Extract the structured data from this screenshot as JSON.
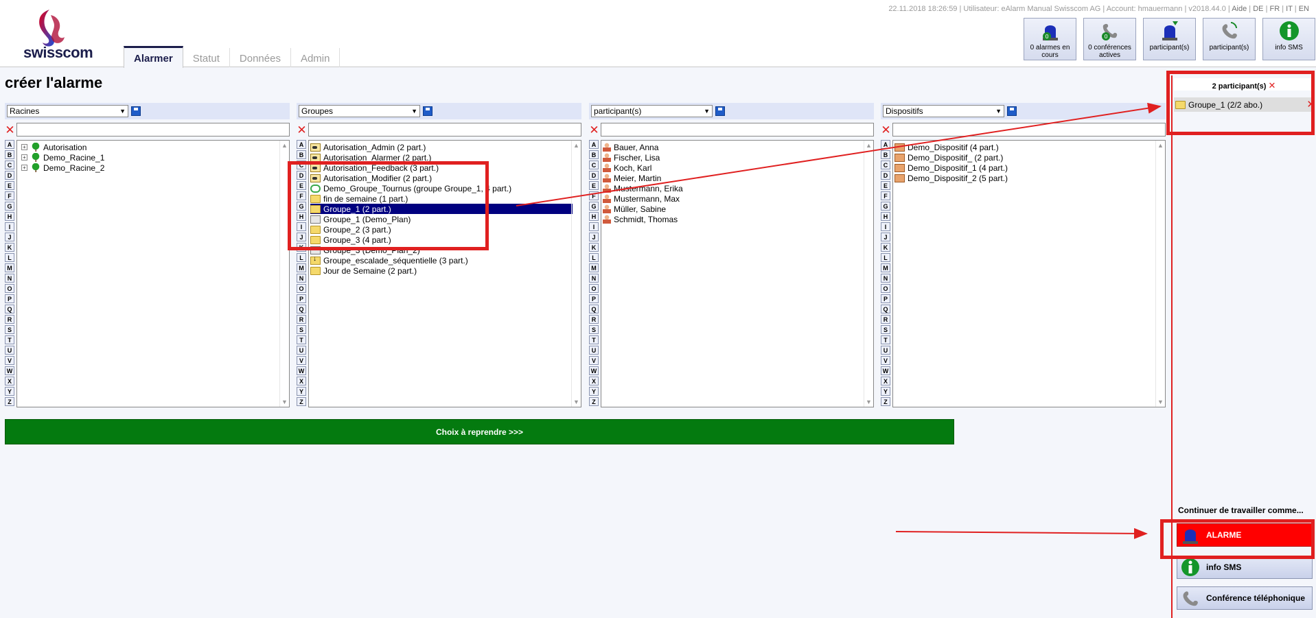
{
  "header": {
    "logo_text": "swisscom",
    "meta": {
      "datetime": "22.11.2018 18:26:59",
      "user_label": "Utilisateur:",
      "user": "eAlarm Manual Swisscom AG",
      "account_label": "Account:",
      "account": "hmauermann",
      "version": "v2018.44.0",
      "help": "Aide",
      "langs": [
        "DE",
        "FR",
        "IT",
        "EN"
      ]
    },
    "tabs": [
      {
        "label": "Alarmer",
        "active": true
      },
      {
        "label": "Statut",
        "active": false
      },
      {
        "label": "Données",
        "active": false
      },
      {
        "label": "Admin",
        "active": false
      }
    ],
    "buttons": [
      {
        "label": "0 alarmes en cours",
        "icon": "alarm-light-icon"
      },
      {
        "label": "0 conférences actives",
        "icon": "conference-icon"
      },
      {
        "label": "participant(s)",
        "icon": "alarm-light-icon"
      },
      {
        "label": "participant(s)",
        "icon": "phone-icon"
      },
      {
        "label": "info SMS",
        "icon": "info-icon"
      }
    ]
  },
  "page_title": "créer l'alarme",
  "letters": [
    "A",
    "B",
    "C",
    "D",
    "E",
    "F",
    "G",
    "H",
    "I",
    "J",
    "K",
    "L",
    "M",
    "N",
    "O",
    "P",
    "Q",
    "R",
    "S",
    "T",
    "U",
    "V",
    "W",
    "X",
    "Y",
    "Z"
  ],
  "columns": [
    {
      "select": "Racines",
      "items": [
        {
          "label": "Autorisation",
          "icon": "tree"
        },
        {
          "label": "Demo_Racine_1",
          "icon": "tree"
        },
        {
          "label": "Demo_Racine_2",
          "icon": "tree"
        }
      ]
    },
    {
      "select": "Groupes",
      "items": [
        {
          "label": "Autorisation_Admin (2 part.)",
          "icon": "key"
        },
        {
          "label": "Autorisation_Alarmer (2 part.)",
          "icon": "key"
        },
        {
          "label": "Autorisation_Feedback (3 part.)",
          "icon": "key"
        },
        {
          "label": "Autorisation_Modifier (2 part.)",
          "icon": "key"
        },
        {
          "label": "Demo_Groupe_Tournus (groupe Groupe_1, 4 part.)",
          "icon": "cycle"
        },
        {
          "label": "fin de semaine (1 part.)",
          "icon": "folder"
        },
        {
          "label": "Groupe_1 (2 part.)",
          "icon": "folder",
          "selected": true
        },
        {
          "label": "Groupe_1 (Demo_Plan)",
          "icon": "plan"
        },
        {
          "label": "Groupe_2 (3 part.)",
          "icon": "folder"
        },
        {
          "label": "Groupe_3 (4 part.)",
          "icon": "folder"
        },
        {
          "label": "Groupe_3 (Demo_Plan_2)",
          "icon": "plan"
        },
        {
          "label": "Groupe_escalade_séquentielle (3 part.)",
          "icon": "escalation"
        },
        {
          "label": "Jour de Semaine (2 part.)",
          "icon": "folder"
        }
      ]
    },
    {
      "select": "participant(s)",
      "items": [
        {
          "label": "Bauer, Anna",
          "icon": "person"
        },
        {
          "label": "Fischer, Lisa",
          "icon": "person"
        },
        {
          "label": "Koch, Karl",
          "icon": "person"
        },
        {
          "label": "Meier, Martin",
          "icon": "person"
        },
        {
          "label": "Mustermann, Erika",
          "icon": "person"
        },
        {
          "label": "Mustermann, Max",
          "icon": "person"
        },
        {
          "label": "Müller, Sabine",
          "icon": "person"
        },
        {
          "label": "Schmidt, Thomas",
          "icon": "person"
        }
      ]
    },
    {
      "select": "Dispositifs",
      "items": [
        {
          "label": "Demo_Dispositif (4 part.)",
          "icon": "device"
        },
        {
          "label": "Demo_Dispositif_ (2 part.)",
          "icon": "device"
        },
        {
          "label": "Demo_Dispositif_1 (4 part.)",
          "icon": "device"
        },
        {
          "label": "Demo_Dispositif_2 (5 part.)",
          "icon": "device"
        }
      ]
    }
  ],
  "choose_button": "Choix à reprendre >>>",
  "selection": {
    "header": "2 participant(s)",
    "items": [
      "Groupe_1 (2/2 abo.)"
    ]
  },
  "continue_label": "Continuer de travailler comme...",
  "actions": [
    {
      "label": "ALARME",
      "icon": "alarm-light-icon"
    },
    {
      "label": "info SMS",
      "icon": "info-icon"
    },
    {
      "label": "Conférence téléphonique",
      "icon": "phone-icon"
    }
  ],
  "colors": {
    "accent_navy": "#1b1d4b",
    "green_button": "#047a0f",
    "alarm_red": "#ff0000",
    "annotation_red": "#e02020",
    "selection_row": "#000080"
  }
}
